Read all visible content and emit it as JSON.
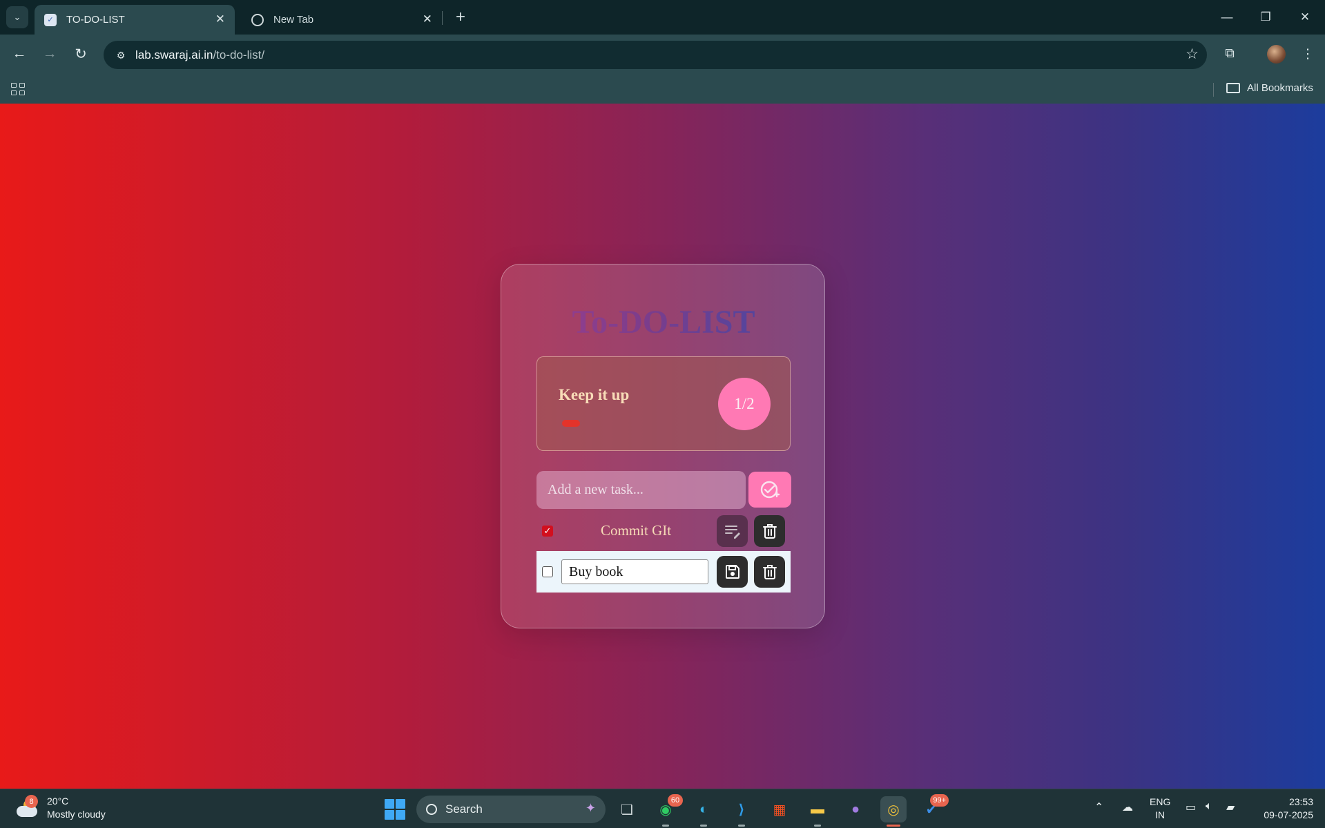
{
  "browser": {
    "tabs": [
      {
        "title": "TO-DO-LIST",
        "active": true
      },
      {
        "title": "New Tab",
        "active": false
      }
    ],
    "address": {
      "host": "lab.swaraj.ai.in",
      "path": "/to-do-list/"
    },
    "bookmarks_bar": {
      "all_bookmarks_label": "All Bookmarks"
    }
  },
  "app": {
    "title": "To-DO-LIST",
    "stats": {
      "label": "Keep it up",
      "completed": 1,
      "total": 2,
      "progress_text": "1/2"
    },
    "new_task": {
      "placeholder": "Add a new task...",
      "value": ""
    },
    "tasks": [
      {
        "text": "Commit GIt",
        "done": true,
        "editing": false
      },
      {
        "text": "Buy book",
        "done": false,
        "editing": true
      }
    ],
    "colors": {
      "accent_pink": "#ff79b4",
      "check_red": "#d20f1e",
      "progress_fill": "#e4332a"
    }
  },
  "taskbar": {
    "weather": {
      "temp": "20°C",
      "condition": "Mostly cloudy",
      "badge": "8"
    },
    "search_label": "Search",
    "badges": {
      "whatsapp": "60",
      "todo": "99+"
    },
    "language": {
      "line1": "ENG",
      "line2": "IN"
    },
    "clock": {
      "time": "23:53",
      "date": "09-07-2025"
    }
  }
}
